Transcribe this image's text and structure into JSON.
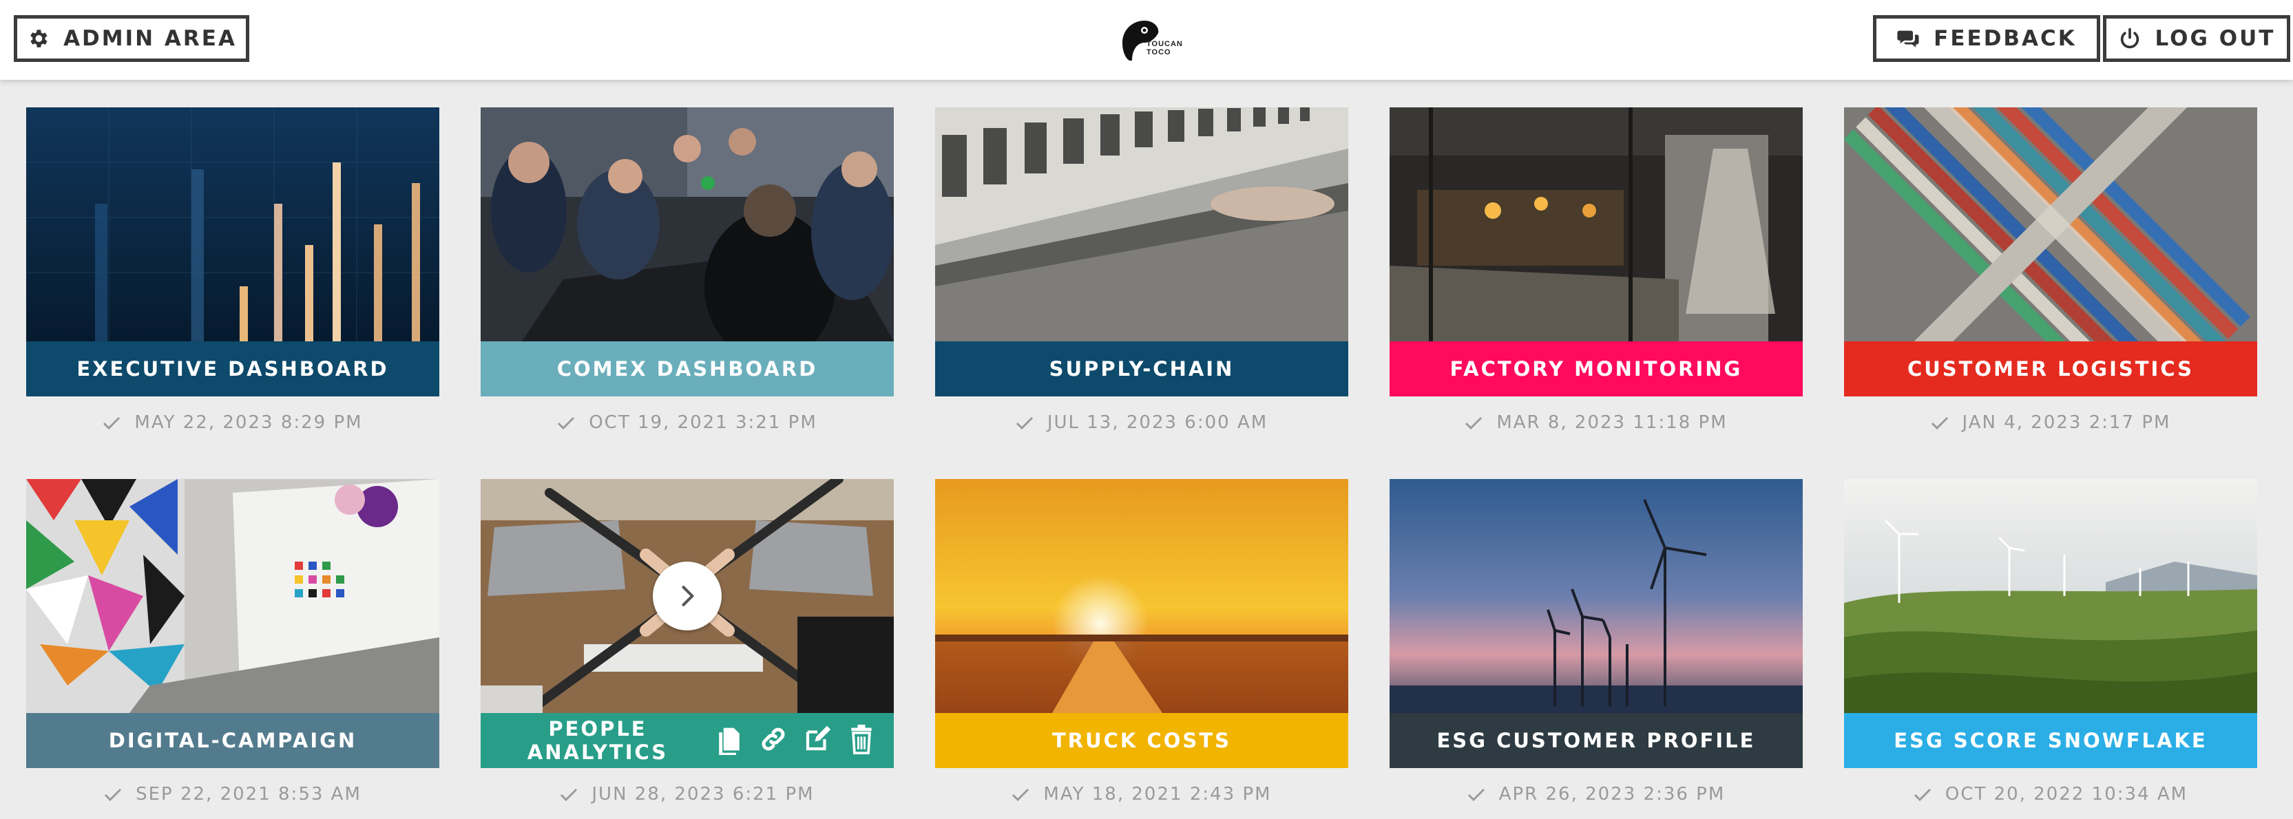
{
  "header": {
    "admin_label": "ADMIN AREA",
    "feedback_label": "FEEDBACK",
    "logout_label": "LOG OUT",
    "logo_line1": "TOUCAN",
    "logo_line2": "TOCO"
  },
  "apps": [
    {
      "title": "EXECUTIVE DASHBOARD",
      "date": "MAY 22, 2023 8:29 PM",
      "color": "#0d4a6b",
      "image": "financial-chart-photo"
    },
    {
      "title": "COMEX DASHBOARD",
      "date": "OCT 19, 2021 3:21 PM",
      "color": "#6aaebb",
      "image": "meeting-photo"
    },
    {
      "title": "SUPPLY-CHAIN",
      "date": "JUL 13, 2023 6:00 AM",
      "color": "#0d4a6b",
      "image": "machinery-photo"
    },
    {
      "title": "FACTORY MONITORING",
      "date": "MAR 8, 2023 11:18 PM",
      "color": "#ff0a5c",
      "image": "factory-photo"
    },
    {
      "title": "CUSTOMER LOGISTICS",
      "date": "JAN 4, 2023 2:17 PM",
      "color": "#e52a1f",
      "image": "containers-photo"
    },
    {
      "title": "DIGITAL-CAMPAIGN",
      "date": "SEP 22, 2021 8:53 AM",
      "color": "#537b8e",
      "image": "laptop-colors-photo"
    },
    {
      "title_line1": "PEOPLE",
      "title_line2": "ANALYTICS",
      "date": "JUN 28, 2023 6:21 PM",
      "color": "#289e89",
      "image": "team-hands-photo"
    },
    {
      "title": "TRUCK COSTS",
      "date": "MAY 18, 2021 2:43 PM",
      "color": "#f1b400",
      "image": "sunset-road-photo"
    },
    {
      "title": "ESG CUSTOMER PROFILE",
      "date": "APR 26, 2023 2:36 PM",
      "color": "#2e3b42",
      "image": "wind-turbines-sky-photo"
    },
    {
      "title": "ESG SCORE SNOWFLAKE",
      "date": "OCT 20, 2022 10:34 AM",
      "color": "#2baee6",
      "image": "wind-turbines-hills-photo"
    }
  ],
  "icons": {
    "admin": "gear-icon",
    "feedback": "chat-bubbles-icon",
    "logout": "power-icon",
    "date": "check-icon",
    "actions": [
      "duplicate-icon",
      "link-icon",
      "edit-icon",
      "trash-icon"
    ],
    "play": "chevron-right-icon"
  }
}
